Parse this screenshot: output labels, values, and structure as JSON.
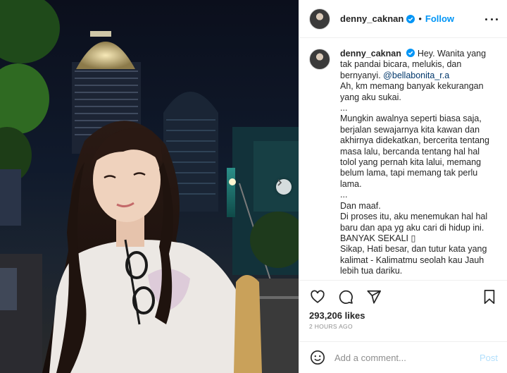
{
  "post": {
    "username": "denny_caknan",
    "verified": true,
    "separator": "•",
    "follow_label": "Follow"
  },
  "caption": {
    "username": "denny_caknan",
    "line1": "Hey. Wanita yang tak pandai bicara, melukis, dan bernyanyi.",
    "mention": "@bellabonita_r.a",
    "body": "Ah, km memang banyak kekurangan yang aku sukai.\n...\nMungkin awalnya seperti biasa saja, berjalan sewajarnya kita kawan dan akhirnya didekatkan, bercerita tentang masa lalu, bercanda tentang hal hal tolol yang pernah kita lalui, memang belum lama, tapi memang tak perlu lama.\n...\nDan maaf.\nDi proses itu, aku menemukan hal hal baru dan apa yg aku cari di hidup ini.\nBANYAK SEKALI ▯\nSikap, Hati besar, dan tutur kata yang kalimat - Kalimatmu seolah kau Jauh lebih tua dariku."
  },
  "stats": {
    "likes": "293,206 likes",
    "time": "2 HOURS AGO"
  },
  "comment": {
    "placeholder": "Add a comment...",
    "post_label": "Post"
  },
  "icons": {
    "like": "heart-icon",
    "comment": "comment-icon",
    "share": "share-icon",
    "save": "bookmark-icon",
    "emoji": "emoji-icon",
    "more": "more-options-icon",
    "next": "chevron-right-icon",
    "verified": "verified-badge-icon"
  },
  "colors": {
    "accent": "#0095f6",
    "mention": "#00376b",
    "muted": "#8e8e8e",
    "post_disabled": "#b2dffc"
  }
}
